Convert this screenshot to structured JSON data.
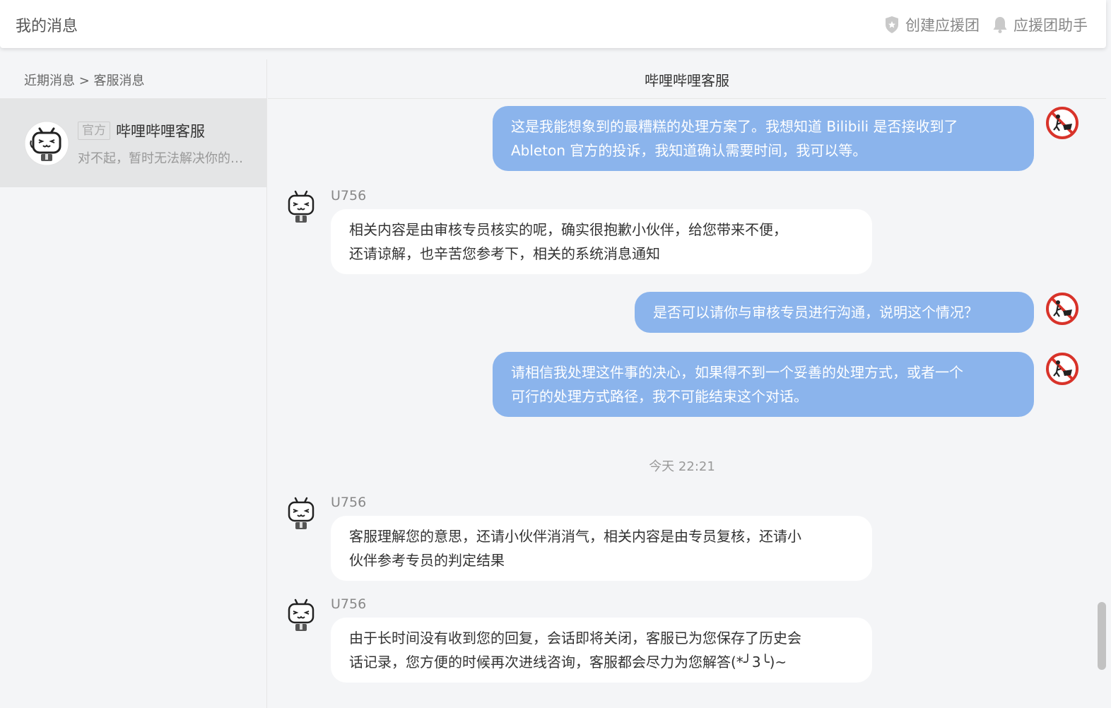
{
  "header": {
    "title": "我的消息",
    "actions": [
      {
        "label": "创建应援团",
        "icon": "shield-icon"
      },
      {
        "label": "应援团助手",
        "icon": "bell-icon"
      }
    ]
  },
  "sidebar": {
    "breadcrumb": "近期消息 > 客服消息",
    "session": {
      "badge": "官方",
      "name": "哔哩哔哩客服",
      "preview": "对不起，暂时无法解决你的问题"
    }
  },
  "chat": {
    "title": "哔哩哔哩客服",
    "messages": [
      {
        "from": "me",
        "text_lines": [
          "这是我能想象到的最糟糕的处理方案了。我想知道 Bilibili 是否接收到了",
          "Ableton 官方的投诉，我知道确认需要时间，我可以等。"
        ]
      },
      {
        "from": "agent",
        "sender": "U756",
        "text_lines": [
          "相关内容是由审核专员核实的呢，确实很抱歉小伙伴，给您带来不便，",
          "还请谅解，也辛苦您参考下，相关的系统消息通知"
        ]
      },
      {
        "from": "me",
        "text_lines": [
          "是否可以请你与审核专员进行沟通，说明这个情况？"
        ]
      },
      {
        "from": "me",
        "text_lines": [
          "请相信我处理这件事的决心，如果得不到一个妥善的处理方式，或者一个",
          "可行的处理方式路径，我不可能结束这个对话。"
        ]
      },
      {
        "from": "time",
        "text": "今天 22:21"
      },
      {
        "from": "agent",
        "sender": "U756",
        "text_lines": [
          "客服理解您的意思，还请小伙伴消消气，相关内容是由专员复核，还请小",
          "伙伴参考专员的判定结果"
        ]
      },
      {
        "from": "agent",
        "sender": "U756",
        "text_lines": [
          "由于长时间没有收到您的回复，会话即将关闭，客服已为您保存了历史会",
          "话记录，您方便的时候再次进线咨询，客服都会尽力为您解答(*╯3╰)~"
        ]
      }
    ]
  }
}
